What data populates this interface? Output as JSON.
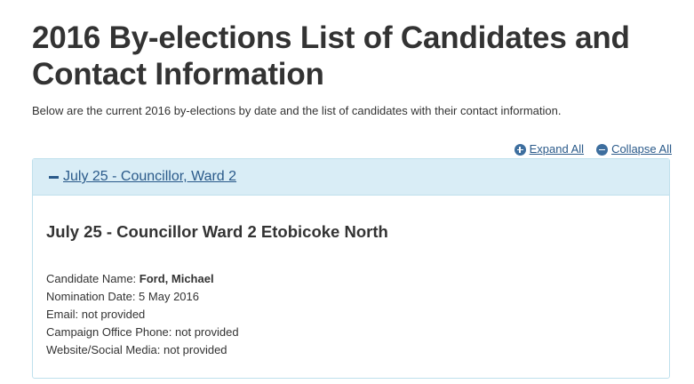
{
  "page": {
    "title": "2016 By-elections List of Candidates and Contact Information",
    "intro": "Below are the current 2016 by-elections by date and the list of candidates with their contact information."
  },
  "controls": {
    "expand_all": "Expand All",
    "collapse_all": "Collapse All",
    "expand_icon": "plus-circle-icon",
    "collapse_icon": "minus-circle-icon"
  },
  "accordion": {
    "panel_title": "July 25 - Councillor, Ward 2",
    "panel_icon": "minus-icon",
    "section_title": "July 25 - Councillor Ward 2 Etobicoke North",
    "candidate": {
      "name_label": "Candidate Name: ",
      "name_value": "Ford, Michael",
      "nomination": "Nomination Date: 5 May 2016",
      "email": "Email: not provided",
      "phone": "Campaign Office Phone: not provided",
      "website": "Website/Social Media: not provided"
    }
  },
  "colors": {
    "link": "#2a5a8a",
    "panel_heading_bg": "#d9edf6",
    "panel_border": "#bfe0ec",
    "text": "#333333"
  }
}
